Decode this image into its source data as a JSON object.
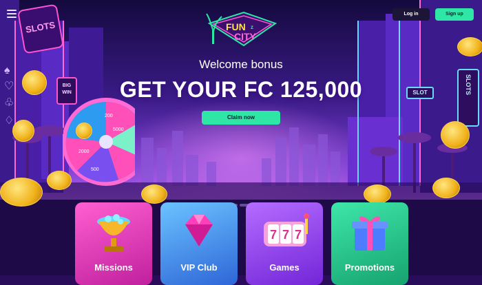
{
  "header": {
    "login_label": "Log in",
    "signup_label": "Sign up"
  },
  "logo": {
    "line1": "FUN",
    "badge": "z",
    "line2": "CITY"
  },
  "hero": {
    "subtitle": "Welcome bonus",
    "headline": "GET YOUR FC 125,000",
    "cta_label": "Claim now"
  },
  "signs": {
    "slots_left": "SLOTS",
    "big_win": "BIG WIN",
    "slots_right": "SLOTS",
    "slot_small": "SLOT"
  },
  "wheel": {
    "values": [
      "200",
      "5000",
      "2000",
      "200",
      "500"
    ]
  },
  "categories": [
    {
      "label": "Missions",
      "icon": "trophy-icon",
      "color": "#e23fbf"
    },
    {
      "label": "VIP Club",
      "icon": "diamond-icon",
      "color": "#4ba2f0"
    },
    {
      "label": "Games",
      "icon": "slot-reels-icon",
      "color": "#9c4ef0"
    },
    {
      "label": "Promotions",
      "icon": "gift-icon",
      "color": "#22c38a"
    }
  ],
  "colors": {
    "accent": "#2ee6a6",
    "background": "#2a0d5a"
  }
}
